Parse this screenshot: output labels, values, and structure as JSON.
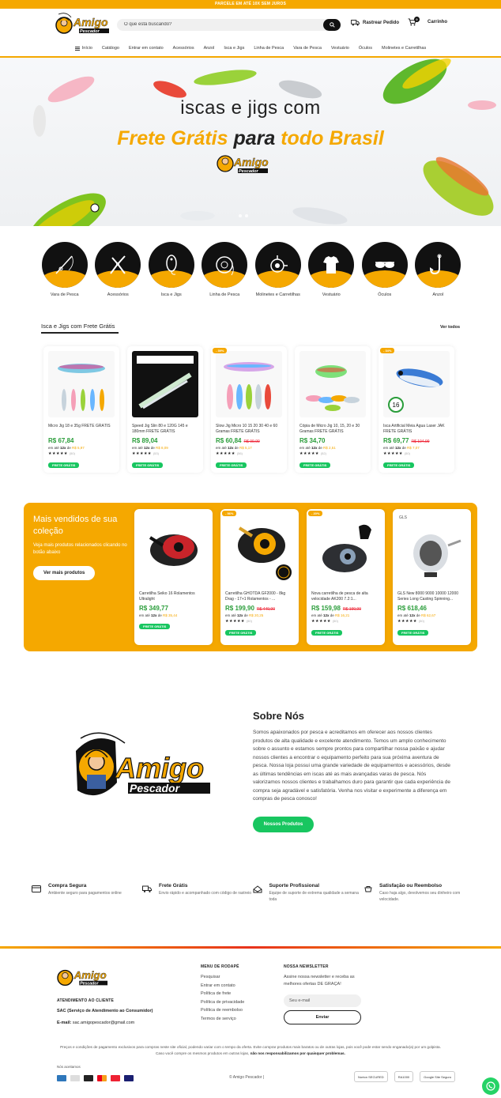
{
  "topbar": {
    "text": "PARCELE EM ATÉ 10X SEM JUROS"
  },
  "brand": {
    "name": "Amigo",
    "sub": "Pescador",
    "accent": "#f5a800",
    "green": "#18c660"
  },
  "search": {
    "placeholder": "O que está buscando?"
  },
  "header": {
    "track_label": "Rastrear Pedido",
    "cart_label": "Carrinho",
    "cart_count": "0"
  },
  "nav": {
    "items": [
      "Início",
      "Catálogo",
      "Entrar em contato",
      "Acessórios",
      "Anzol",
      "Isca e Jigs",
      "Linha de Pesca",
      "Vara de Pesca",
      "Vestuário",
      "Óculos",
      "Molinetes e Carretilhas"
    ]
  },
  "hero": {
    "line1": "iscas e jigs com",
    "line2_a": "Frete Grátis ",
    "line2_b": "para ",
    "line2_c": "todo Brasil"
  },
  "categories": [
    {
      "label": "Vara de Pesca",
      "icon": "fishing-rod-icon"
    },
    {
      "label": "Acessórios",
      "icon": "pliers-icon"
    },
    {
      "label": "Isca e Jigs",
      "icon": "lure-icon"
    },
    {
      "label": "Linha de Pesca",
      "icon": "fishing-line-icon"
    },
    {
      "label": "Molinetes e Carretilhas",
      "icon": "reel-icon"
    },
    {
      "label": "Vestuário",
      "icon": "clothing-icon"
    },
    {
      "label": "Óculos",
      "icon": "sunglasses-icon"
    },
    {
      "label": "Anzol",
      "icon": "hook-icon"
    }
  ],
  "section1": {
    "title": "Isca e Jigs com Frete Grátis",
    "view_all": "Ver todos"
  },
  "products1": [
    {
      "tag": "",
      "name": "Micro Jig 18 e 35g FRETE GRÁTIS",
      "price": "R$ 67,84",
      "old": "",
      "inst_a": "em até ",
      "inst_b": "12x",
      "inst_c": " de ",
      "inst_d": "R$ 5,97",
      "reviews": "(50)",
      "free": "FRETE GRÁTIS"
    },
    {
      "tag": "",
      "name": "Speed Jig Slin 80 e 120G 145 e 180mm FRETE GRÁTIS",
      "price": "R$ 89,04",
      "old": "",
      "inst_a": "em até ",
      "inst_b": "12x",
      "inst_c": " de ",
      "inst_d": "R$ 8,09",
      "reviews": "(53)",
      "free": "FRETE GRÁTIS"
    },
    {
      "tag": "- 39%",
      "name": "Slow Jig Micro 10 15 20 30 40 e 60 Gramas FRETE GRÁTIS",
      "price": "R$ 60,84",
      "old": "R$ 99,99",
      "inst_a": "em até ",
      "inst_b": "12x",
      "inst_c": " de ",
      "inst_d": "R$ 5,17",
      "reviews": "(56)",
      "free": "FRETE GRÁTIS"
    },
    {
      "tag": "",
      "name": "Cópia de Micro Jig 10, 15, 20 e 30 Gramas FRETE GRÁTIS",
      "price": "R$ 34,70",
      "old": "",
      "inst_a": "em até ",
      "inst_b": "12x",
      "inst_c": " de ",
      "inst_d": "R$ 2,51",
      "reviews": "(52)",
      "free": "FRETE GRÁTIS"
    },
    {
      "tag": "- 34%",
      "name": "Isca Artificial Meia Água Laser JAK FRETE GRÁTIS",
      "price": "R$ 69,77",
      "old": "R$ 104,99",
      "inst_a": "em até ",
      "inst_b": "12x",
      "inst_c": " de ",
      "inst_d": "R$ 7,07",
      "reviews": "(50)",
      "free": "FRETE GRÁTIS"
    }
  ],
  "best": {
    "title": "Mais vendidos de sua coleção",
    "desc": "Veja mais produtos relacionados clicando no botão abaixo",
    "button": "Ver mais produtos",
    "products": [
      {
        "tag": "",
        "brand": "",
        "name": "Carretilha Seiko 16 Rolamentos Ultralight",
        "price": "R$ 349,77",
        "old": "",
        "inst_a": "em até ",
        "inst_b": "12x",
        "inst_c": " de ",
        "inst_d": "R$ 35,44",
        "reviews": "",
        "free": "FRETE GRÁTIS"
      },
      {
        "tag": "- 56%",
        "brand": "",
        "name": "Carretilha GHOTDA GF2000 - 8kg Drag - 17+1 Rolamentos - ...",
        "price": "R$ 199,90",
        "old": "R$ 449,90",
        "inst_a": "em até ",
        "inst_b": "12x",
        "inst_c": " de ",
        "inst_d": "R$ 20,25",
        "reviews": "(50)",
        "free": "FRETE GRÁTIS"
      },
      {
        "tag": "- 20%",
        "brand": "",
        "name": "Nova carretilha de pesca de alta velocidade AK200 7.2:1...",
        "price": "R$ 159,98",
        "old": "R$ 199,99",
        "inst_a": "em até ",
        "inst_b": "12x",
        "inst_c": " de ",
        "inst_d": "R$ 16,21",
        "reviews": "(50)",
        "free": "FRETE GRÁTIS"
      },
      {
        "tag": "",
        "brand": "GLS",
        "name": "GLS New 8000 9000 10000 12000 Series Long Casting Spinning...",
        "price": "R$ 618,46",
        "old": "",
        "inst_a": "em até ",
        "inst_b": "12x",
        "inst_c": " de ",
        "inst_d": "R$ 62,67",
        "reviews": "(50)",
        "free": "FRETE GRÁTIS"
      }
    ]
  },
  "about": {
    "title": "Sobre Nós",
    "text": "Somos apaixonados por pesca e acreditamos em oferecer aos nossos clientes produtos de alta qualidade e excelente atendimento. Temos um amplo conhecimento sobre o assunto e estamos sempre prontos para compartilhar nossa paixão e ajudar nossos clientes a encontrar o equipamento perfeito para sua próxima aventura de pesca. Nossa loja possui uma grande variedade de equipamentos e acessórios, desde as últimas tendências em iscas até as mais avançadas varas de pesca. Nós valorizamos nossos clientes e trabalhamos duro para garantir que cada experiência de compra seja agradável e satisfatória. Venha nos visitar e experimente a diferença em compras de pesca conosco!",
    "button": "Nossos Produtos"
  },
  "features": [
    {
      "title": "Compra Segura",
      "desc": "Ambiente seguro para pagamentos online",
      "icon": "secure-card-icon"
    },
    {
      "title": "Frete Grátis",
      "desc": "Envio rápido e acompanhado com código de rastreio",
      "icon": "truck-icon"
    },
    {
      "title": "Suporte Profissional",
      "desc": "Equipe de suporte de extrema qualidade a semana toda",
      "icon": "support-icon"
    },
    {
      "title": "Satisfação ou Reembolso",
      "desc": "Caso haja algo, devolvemos seu dinheiro com velocidade.",
      "icon": "refund-icon"
    }
  ],
  "footer": {
    "support_head": "ATENDIMENTO AO CLIENTE",
    "sac": "SAC (Serviço de Atendimento ao Consumidor)",
    "email_label": "E-mail:",
    "email": "sac.amigopescador@gmail.com",
    "menu_head": "MENU DE RODAPÉ",
    "menu": [
      "Pesquisar",
      "Entrar em contato",
      "Política de frete",
      "Política de privacidade",
      "Política de reembolso",
      "Termos de serviço"
    ],
    "news_head": "NOSSA NEWSLETTER",
    "news_text": "Assine nossa newsletter e receba as melhores ofertas DE GRAÇA!",
    "news_placeholder": "Seu e-mail",
    "news_button": "Enviar",
    "legal_a": "Preços e condições de pagamento exclusivos para compras neste site oficial, podendo variar com o tempo da oferta. Evite comprar produtos mais baratos ou de outras lojas, pois você pode estar sendo enganado(a) por um golpista. Caso você compre os mesmos produtos em outras lojas, ",
    "legal_b": "não nos responsabilizamos por quaisquer problemas.",
    "pay_label": "Nós aceitamos",
    "copyright": "© Amigo Pescador |",
    "seals": [
      "Norton SECURED",
      "RA1000",
      "Google Site Seguro"
    ]
  }
}
